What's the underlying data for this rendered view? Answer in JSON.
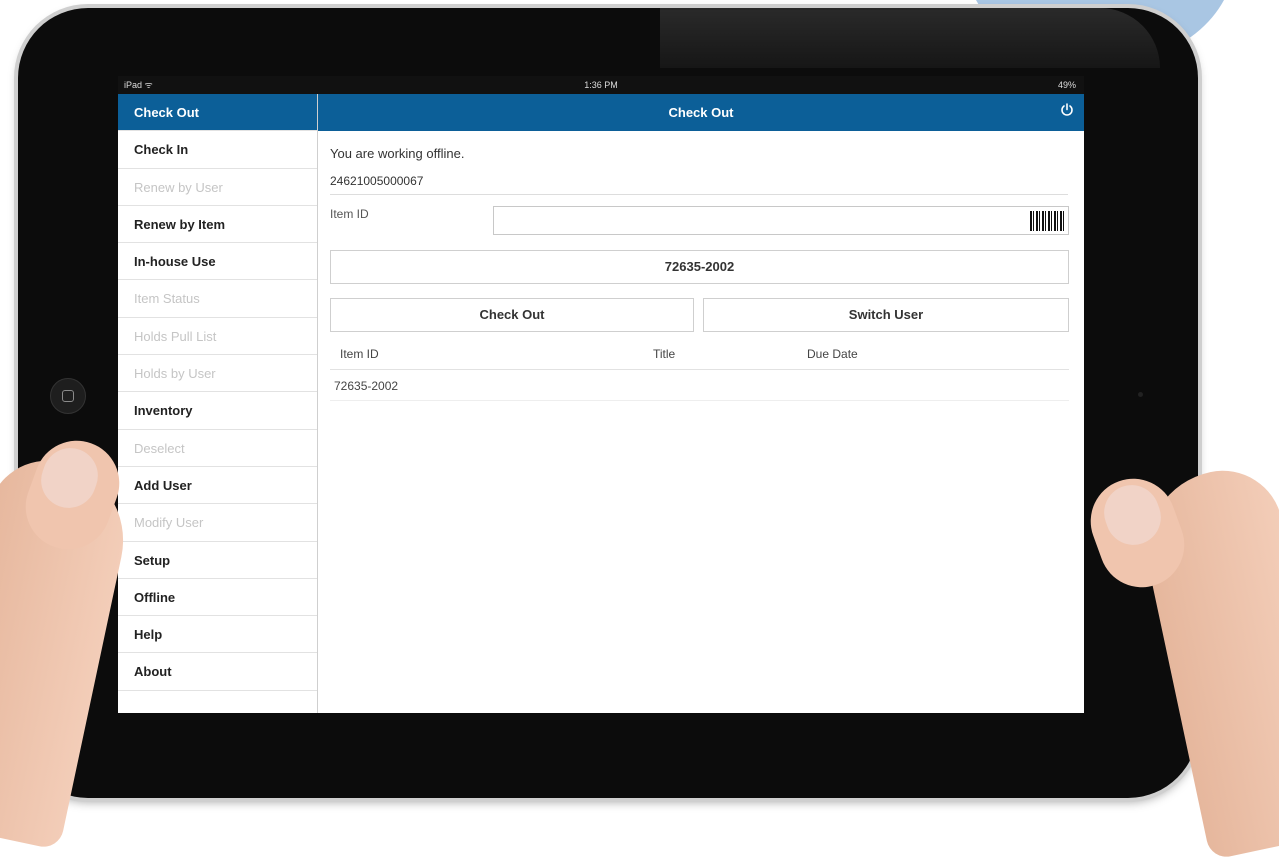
{
  "colors": {
    "accent": "#0c5f98",
    "background": "#ffffff",
    "disabled_text": "#c5c5c5"
  },
  "statusbar": {
    "left": "iPad ᯤ",
    "time": "1:36 PM",
    "right": "49%"
  },
  "sidebar": {
    "items": [
      {
        "label": "Check Out",
        "state": "active"
      },
      {
        "label": "Check In",
        "state": "enabled"
      },
      {
        "label": "Renew by User",
        "state": "disabled"
      },
      {
        "label": "Renew by Item",
        "state": "enabled"
      },
      {
        "label": "In-house Use",
        "state": "enabled"
      },
      {
        "label": "Item Status",
        "state": "disabled"
      },
      {
        "label": "Holds Pull List",
        "state": "disabled"
      },
      {
        "label": "Holds by User",
        "state": "disabled"
      },
      {
        "label": "Inventory",
        "state": "enabled"
      },
      {
        "label": "Deselect",
        "state": "disabled"
      },
      {
        "label": "Add User",
        "state": "enabled"
      },
      {
        "label": "Modify User",
        "state": "disabled"
      },
      {
        "label": "Setup",
        "state": "enabled"
      },
      {
        "label": "Offline",
        "state": "enabled"
      },
      {
        "label": "Help",
        "state": "enabled"
      },
      {
        "label": "About",
        "state": "enabled"
      }
    ]
  },
  "header": {
    "title": "Check Out",
    "power_icon": "power-icon"
  },
  "main": {
    "offline_message": "You are working offline.",
    "user_id": "24621005000067",
    "item_id_label": "Item ID",
    "item_id_value": "",
    "barcode_icon": "barcode-icon",
    "item_value_button": "72635-2002",
    "checkout_button": "Check Out",
    "switch_user_button": "Switch User",
    "table": {
      "headers": {
        "item_id": "Item ID",
        "title": "Title",
        "due_date": "Due Date"
      },
      "rows": [
        {
          "item_id": "72635-2002",
          "title": "",
          "due_date": ""
        }
      ]
    }
  }
}
